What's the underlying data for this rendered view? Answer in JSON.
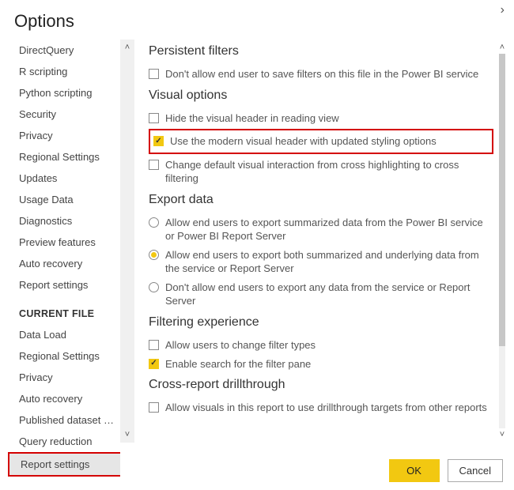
{
  "title": "Options",
  "sidebar": {
    "global_items": [
      "DirectQuery",
      "R scripting",
      "Python scripting",
      "Security",
      "Privacy",
      "Regional Settings",
      "Updates",
      "Usage Data",
      "Diagnostics",
      "Preview features",
      "Auto recovery",
      "Report settings"
    ],
    "current_file_header": "CURRENT FILE",
    "current_file_items": [
      "Data Load",
      "Regional Settings",
      "Privacy",
      "Auto recovery",
      "Published dataset set...",
      "Query reduction",
      "Report settings"
    ],
    "selected": "Report settings"
  },
  "sections": {
    "persistent": {
      "heading": "Persistent filters",
      "opt0": "Don't allow end user to save filters on this file in the Power BI service"
    },
    "visual": {
      "heading": "Visual options",
      "opt0": "Hide the visual header in reading view",
      "opt1": "Use the modern visual header with updated styling options",
      "opt2": "Change default visual interaction from cross highlighting to cross filtering"
    },
    "export": {
      "heading": "Export data",
      "opt0": "Allow end users to export summarized data from the Power BI service or Power BI Report Server",
      "opt1": "Allow end users to export both summarized and underlying data from the service or Report Server",
      "opt2": "Don't allow end users to export any data from the service or Report Server"
    },
    "filtering": {
      "heading": "Filtering experience",
      "opt0": "Allow users to change filter types",
      "opt1": "Enable search for the filter pane"
    },
    "drill": {
      "heading": "Cross-report drillthrough",
      "opt0": "Allow visuals in this report to use drillthrough targets from other reports"
    }
  },
  "buttons": {
    "ok": "OK",
    "cancel": "Cancel"
  }
}
